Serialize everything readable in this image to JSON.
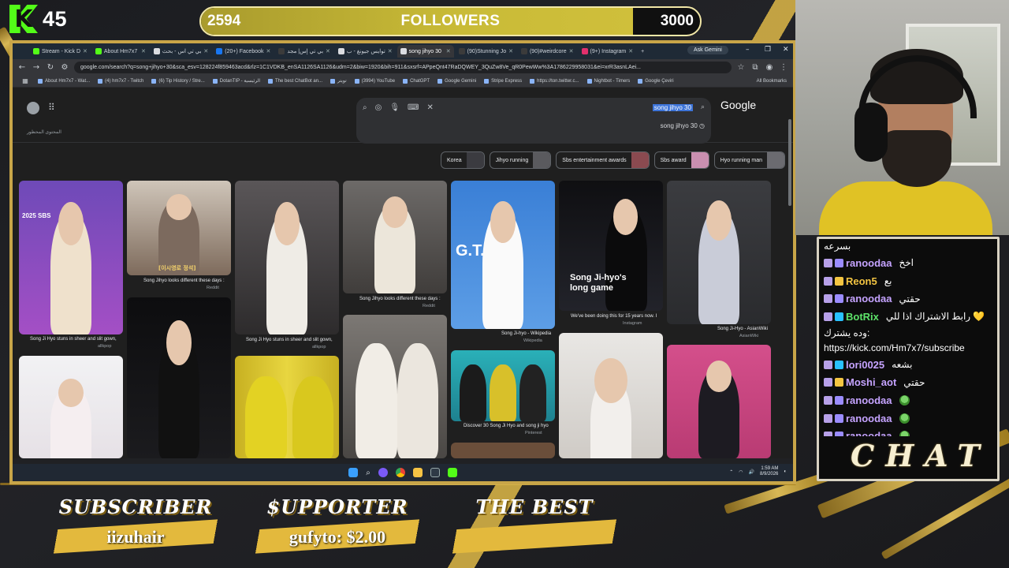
{
  "overlay": {
    "kick_count": "45",
    "followers": {
      "current": "2594",
      "title": "FOLLOWERS",
      "goal": "3000",
      "progress": 0.865
    },
    "chat_label": "CHAT",
    "bottom": [
      {
        "title": "SUBSCRIBER",
        "value": "iizuhair"
      },
      {
        "title": "$UPPORTER",
        "value": "gufyto: $2.00"
      },
      {
        "title": "THE BEST",
        "value": ""
      }
    ]
  },
  "browser": {
    "tabs": [
      {
        "label": "Stream - Kick D",
        "color": "#53fc18"
      },
      {
        "label": "About Hm7x7",
        "color": "#53fc18"
      },
      {
        "label": "بي تي اس - بحث",
        "color": "#dadce0"
      },
      {
        "label": "(20+) Facebook",
        "color": "#1877f2"
      },
      {
        "label": "بي تي إس| مجد",
        "color": "#3b3b3b"
      },
      {
        "label": "توايس جيونغ - ب",
        "color": "#dadce0"
      },
      {
        "label": "song jihyo 30",
        "color": "#dadce0",
        "active": true
      },
      {
        "label": "(90)Stunning Jo",
        "color": "#3b3b3b"
      },
      {
        "label": "(90)#weirdcore",
        "color": "#3b3b3b"
      },
      {
        "label": "(9+) Instagram",
        "color": "#e1306c"
      }
    ],
    "ask_gemini": "Ask Gemini",
    "url": "google.com/search?q=song+jihyo+30&sca_esv=128224f859463acd&rlz=1C1VDKB_enSA1126SA1126&udm=2&biw=1920&bih=911&sxsrf=APpeQnt47RaDQWEY_3QuZw8Ve_qR0PewWw%3A1786229958031&ei=xrR3asnLAei...",
    "bookmarks": [
      "About Hm7x7 - Wat...",
      "(4) hm7x7 - Twitch",
      "(6) Tip History / Stre...",
      "DotanTIP - الرئيسية",
      "The best ChatBot an...",
      "تويتر",
      "(3994) YouTube",
      "ChatGPT",
      "Google Gemini",
      "Stripe Express",
      "https://ton.twitter.c...",
      "Nightbot - Timers",
      "Google Çeviri"
    ],
    "all_bookmarks": "All Bookmarks"
  },
  "google": {
    "safesearch": "المحتوى المحظور",
    "query": "song jihyo 30",
    "suggestion": "song jihyo 30",
    "logo": "Google",
    "chips": [
      "Korea",
      "Jihyo running",
      "Sbs entertainment awards",
      "Sbs award",
      "Hyo running man"
    ],
    "captions": {
      "c1": "Song Ji Hyo stuns in sheer and slit gown,",
      "c1s": "allkpop",
      "c2": "Song Jihyo looks different these days :",
      "c2s": "Reddit",
      "c3": "Song Ji Hyo stuns in sheer and slit gown,",
      "c3s": "allkpop",
      "c4": "Song Jihyo looks different these days :",
      "c4s": "Reddit",
      "c5": "Song Ji-hyo - Wikipedia",
      "c5s": "Wikipedia",
      "c6": "We've been doing this for 15 years now. I",
      "c6s": "Instagram",
      "c7": "Song Ji-Hyo - AsianWiki",
      "c7s": "AsianWiki",
      "c8": "Discover 30 Song Ji Hyo and song ji hyo",
      "c8s": "Pinterest",
      "overlay_title": "Song Ji-hyo's long game",
      "korean_caption": "[이시영로 정석]",
      "sbs_text": "2025 SBS",
      "sign_text": "G.T.    JH"
    }
  },
  "taskbar": {
    "time": "1:59 AM",
    "date": "8/9/2026"
  },
  "chat": {
    "messages": [
      {
        "user": "",
        "text": "بسرعه",
        "color": "#ffffff"
      },
      {
        "user": "ranoodaa",
        "text": "اخخ",
        "color": "#c5a3ff",
        "badge": "#9b8cff"
      },
      {
        "user": "Reon5",
        "text": "بع",
        "color": "#f4c542",
        "badge": "#f4c542"
      },
      {
        "user": "ranoodaa",
        "text": "حقتي",
        "color": "#c5a3ff",
        "badge": "#9b8cff"
      },
      {
        "user": "BotRix",
        "text": "رابط الاشتراك اذا للي 💛",
        "color": "#5de36a",
        "badge": "#29c1ff"
      },
      {
        "user": "",
        "text": "وده يشترك:",
        "color": "#ffffff"
      },
      {
        "user": "",
        "text": "https://kick.com/Hm7x7/subscribe",
        "color": "#ffffff"
      },
      {
        "user": "lori0025",
        "text": "بشعه",
        "color": "#c5a3ff",
        "badge": "#29c1ff"
      },
      {
        "user": "Moshi_aot",
        "text": "حقتي",
        "color": "#c5a3ff",
        "badge": "#f4c542"
      },
      {
        "user": "ranoodaa",
        "text": "",
        "color": "#c5a3ff",
        "badge": "#9b8cff",
        "emote": true
      },
      {
        "user": "ranoodaa",
        "text": "",
        "color": "#c5a3ff",
        "badge": "#9b8cff",
        "emote": true
      },
      {
        "user": "ranoodaa",
        "text": "",
        "color": "#c5a3ff",
        "badge": "#9b8cff",
        "emote": true
      }
    ]
  }
}
